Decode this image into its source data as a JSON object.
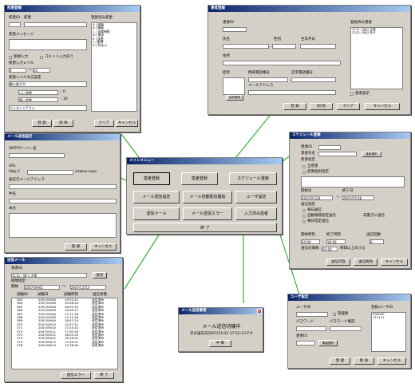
{
  "colors": {
    "connector": "#33b233",
    "titlebar_start": "#0a246a",
    "titlebar_end": "#a6caf0"
  },
  "main": {
    "title": "メインメニュー",
    "buttons": [
      "患者登録",
      "患者登録",
      "スケジュール登録",
      "メール送信設定",
      "メール自動配信開始",
      "ユーザ設定",
      "送信メール",
      "メール送信エラー",
      "入力済み患者",
      "終 了"
    ]
  },
  "disease": {
    "title": "疾患登録",
    "code_label": "疾患ID",
    "name_label": "疾患",
    "message_label": "疾患メッセージ",
    "new_input": "新規入力",
    "comment_input": "コメント入力あり",
    "level_label": "疾患入力レベル",
    "level_from": "0",
    "level_to": "10",
    "level_text_label": "疾患レベル文言設定",
    "level_text_value": "最も調子が",
    "good_label": "いい状態",
    "good_val": ": 0",
    "bad_label": "悪い状態",
    "bad_val": ": 10",
    "hint": "で入力して下さい",
    "list_label": "登録済み疾患",
    "list": [
      "A | 頭痛",
      "B | 腹痛",
      "C | 自律神経",
      "D | 食欲",
      "E | 疾患",
      "F | 動悸",
      "G | めまい"
    ],
    "buttons": [
      "登 録",
      "削 除",
      "クリア",
      "キャンセル"
    ]
  },
  "patient": {
    "title": "患者登録",
    "id_label": "患者ID",
    "name_label": "氏名",
    "sex_label": "性別",
    "birth_label": "生年月日",
    "address_label": "住所",
    "symptom_label": "症状",
    "mobile_label": "携帯電話番号",
    "home_label": "自宅電話番号",
    "mail_label": "メールアドレス",
    "select_symptom": "症状選択",
    "list_label": "登録済み患者",
    "list": [
      "1111 | 岡山 太郎",
      "2222 | 岡山 花子"
    ],
    "show_deleted": "患者表示",
    "buttons": [
      "登 録",
      "削 除",
      "クリア",
      "キャンセル"
    ]
  },
  "mail": {
    "title": "メール送信設定",
    "smtp_label": "SMTPサーバー名",
    "url_label": "URL",
    "url_prefix": "http://",
    "url_suffix": "/status.aspx",
    "from_label": "送信元メールアドレス",
    "subject_label": "件名",
    "body_label": "本文",
    "buttons": [
      "登 録",
      "キャンセル"
    ]
  },
  "sent": {
    "title": "送信メール",
    "patient_label": "患者ID",
    "patient_value": "1111 | 岡山 太郎",
    "show": "表示",
    "period_label": "期間指定",
    "start_label": "開始",
    "start": "2007/09/01",
    "end": "2007/12/13",
    "headers": [
      "試験ID",
      "試験日",
      "試験時刻",
      "送信状態"
    ],
    "rows": [
      [
        "363",
        "2007/09/08",
        "15:51:41",
        "送信済み"
      ],
      [
        "364",
        "2007/09/08",
        "15:56:54",
        "送信済み"
      ],
      [
        "365",
        "2007/09/08",
        "16:03:34",
        "送信済み"
      ],
      [
        "366",
        "2007/09/08",
        "16:09:17",
        "送信済み"
      ],
      [
        "367",
        "2007/09/08",
        "17:17:16",
        "送信済み"
      ],
      [
        "368",
        "2007/09/08",
        "17:21:26",
        "送信済み"
      ],
      [
        "369",
        "2007/09/09",
        "18:57:24",
        "送信済み"
      ],
      [
        "370",
        "2007/09/10",
        "14:57:21",
        "送信済み"
      ],
      [
        "371",
        "2007/09/10",
        "17:25:44",
        "送信済み"
      ],
      [
        "372",
        "2007/09/11",
        "17:30:26",
        "送信済み"
      ],
      [
        "373",
        "2007/09/12",
        "16:01:29",
        "送信済み"
      ],
      [
        "374",
        "2007/09/12",
        "16:16:02",
        "送信済み"
      ],
      [
        "375",
        "2007/09/13",
        "17:24:21",
        "送信済み"
      ],
      [
        "376",
        "2007/09/14",
        "17:28:50",
        "送信済み"
      ]
    ],
    "buttons": [
      "送信エラー",
      "終 了"
    ]
  },
  "schedule": {
    "title": "スケジュール登録",
    "patient_label": "患者ID",
    "name_label": "患者氏名",
    "select": "患者選択",
    "disease_label": "疾患指定",
    "all": "全疾患",
    "specified": "疾患個別指定",
    "start_label": "開始日",
    "start": "2007/07/28",
    "end_label": "終了日",
    "end": "2007/07/28",
    "interval_label": "送信指定",
    "daily": "毎日送信",
    "auto": "自動間隔指定送信",
    "weekday": "曜日指定送信",
    "every_day": "日置きに送信",
    "time_start_label": "開始時刻",
    "time_end_label": "終了時刻",
    "count_label": "送信回数",
    "time_start": "10:00",
    "time_end": "18:00",
    "count": "0",
    "gap_label": "送信の間隔",
    "gap_value": "01:00",
    "gap_note": "時間以上あける",
    "buttons": [
      "送信内容",
      "送信削除",
      "キャンセル"
    ]
  },
  "sending": {
    "title": "メール送信管理",
    "message": "メール送信待機中",
    "next": "次の送信日2007/11/13 17:52:13です",
    "stop": "中 断"
  },
  "user": {
    "title": "ユーザ設定",
    "user_label": "ユーザID",
    "admin": "管理者",
    "password": "パスワード",
    "confirm": "パスワード確認",
    "patient_label": "患者ID",
    "select": "患者選択",
    "list_label": "登録ユーザID",
    "list": [
      "000000",
      "111111"
    ],
    "buttons": [
      "登 録",
      "削 除",
      "キャンセル"
    ]
  }
}
